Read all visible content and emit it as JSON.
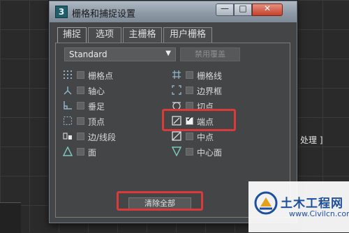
{
  "background": {
    "viewport_text": "处理 ]"
  },
  "window": {
    "app_icon": "3",
    "title": "栅格和捕捉设置",
    "controls": {
      "minimize": "—",
      "maximize": "□",
      "close": "✕"
    }
  },
  "tabs": [
    "捕捉",
    "选项",
    "主栅格",
    "用户栅格"
  ],
  "active_tab": "捕捉",
  "panel": {
    "dropdown_value": "Standard",
    "reset_button": "禁用覆盖",
    "options_left": [
      {
        "icon": "grid-points-icon",
        "label": "栅格点",
        "checked": false
      },
      {
        "icon": "pivot-icon",
        "label": "轴心",
        "checked": false
      },
      {
        "icon": "perpendicular-icon",
        "label": "垂足",
        "checked": false
      },
      {
        "icon": "vertex-icon",
        "label": "顶点",
        "checked": false
      },
      {
        "icon": "edge-segment-icon",
        "label": "边/线段",
        "checked": false
      },
      {
        "icon": "face-icon",
        "label": "面",
        "checked": false
      }
    ],
    "options_right": [
      {
        "icon": "grid-lines-icon",
        "label": "栅格线",
        "checked": false
      },
      {
        "icon": "bounding-box-icon",
        "label": "边界框",
        "checked": false
      },
      {
        "icon": "tangent-icon",
        "label": "切点",
        "checked": false
      },
      {
        "icon": "endpoint-icon",
        "label": "端点",
        "checked": true
      },
      {
        "icon": "midpoint-icon",
        "label": "中点",
        "checked": false
      },
      {
        "icon": "center-face-icon",
        "label": "中心面",
        "checked": false
      }
    ],
    "clear_button": "清除全部"
  },
  "watermark": {
    "title": "土木工程网",
    "url": "www.Civilcn.com"
  },
  "colors": {
    "highlight": "#d93a3a",
    "dialog_bg": "#444546"
  }
}
